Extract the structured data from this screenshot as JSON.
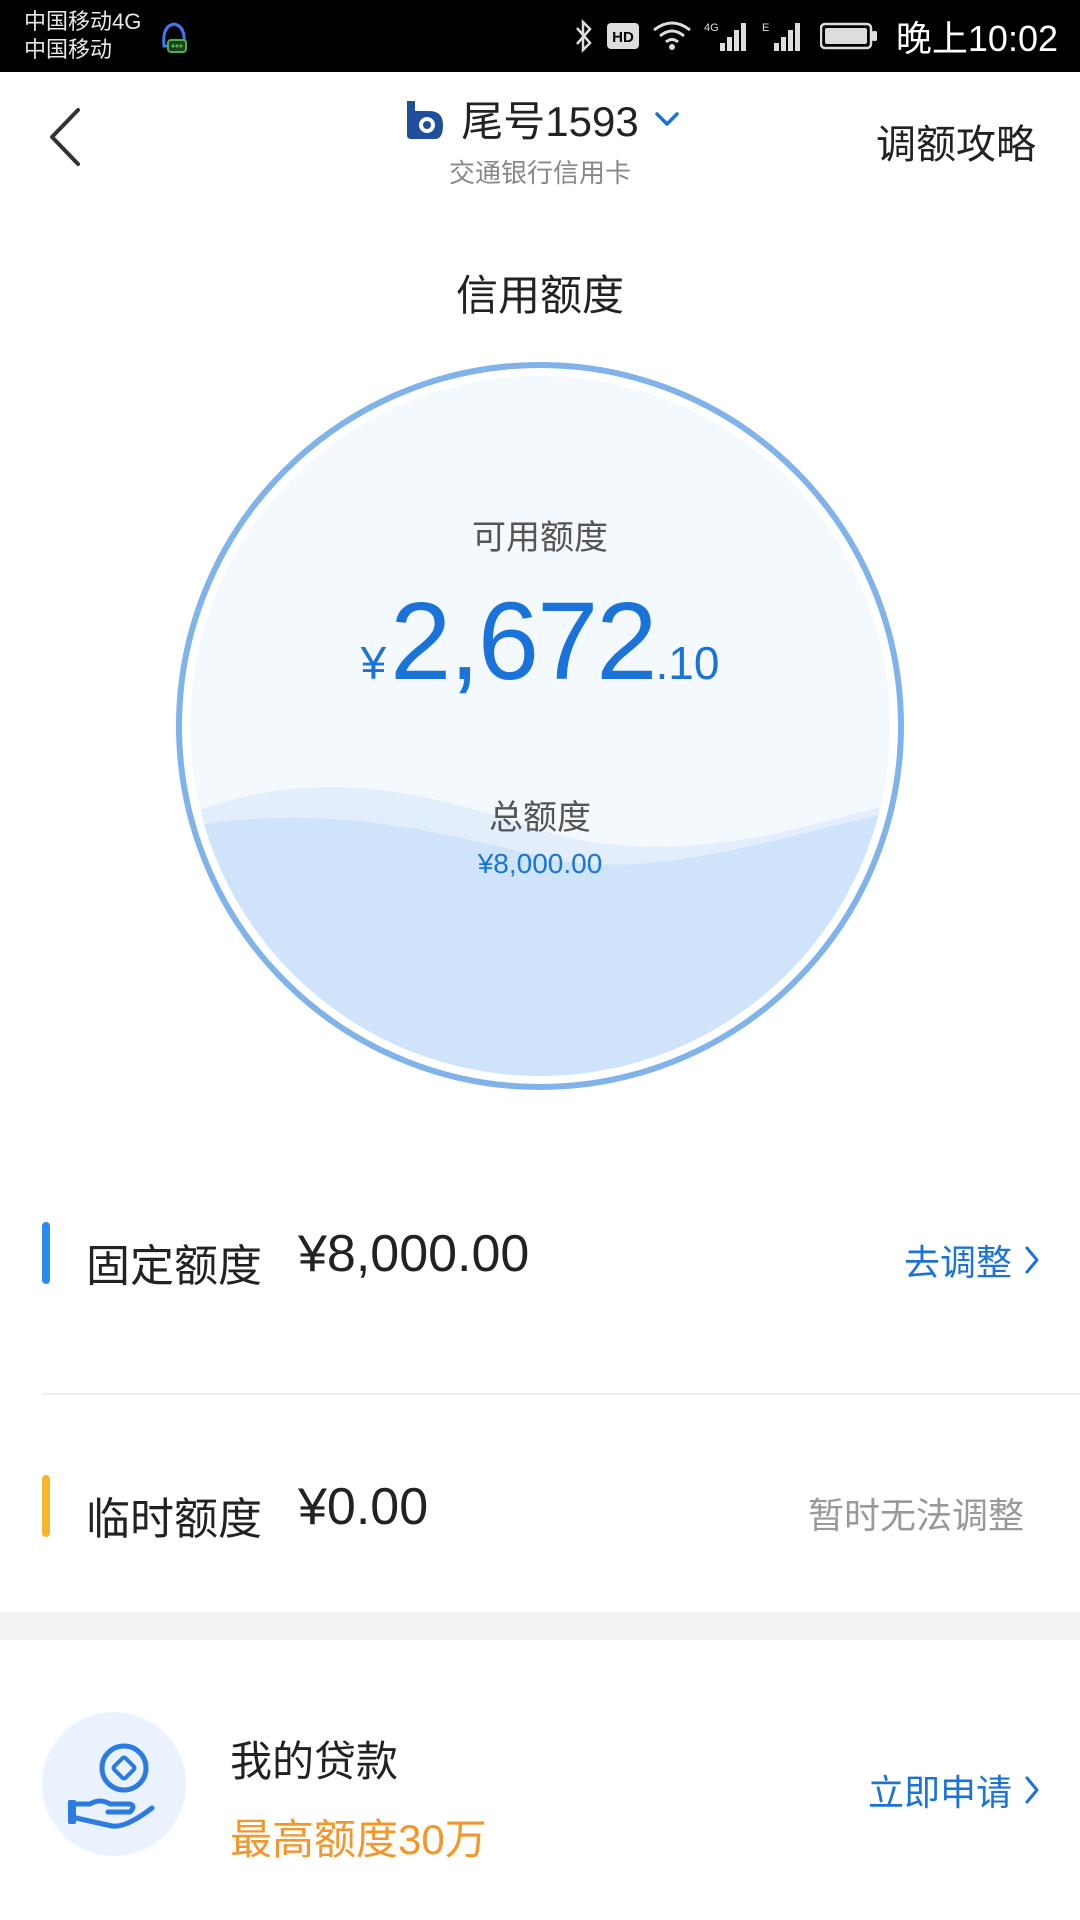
{
  "status_bar": {
    "carrier_line1": "中国移动4G",
    "carrier_line2": "中国移动",
    "time": "晚上10:02",
    "icons": [
      "bluetooth-icon",
      "hd-icon",
      "wifi-icon",
      "signal-4g-icon",
      "signal-e-icon",
      "battery-icon"
    ]
  },
  "header": {
    "title": "尾号1593",
    "subtitle": "交通银行信用卡",
    "right_link": "调额攻略"
  },
  "credit": {
    "section_title": "信用额度",
    "available_label": "可用额度",
    "currency": "¥",
    "available_int": "2,672",
    "available_dec": ".10",
    "total_label": "总额度",
    "total_amount": "¥8,000.00",
    "available_fraction": 0.334
  },
  "fixed": {
    "label": "固定额度",
    "value": "¥8,000.00",
    "action": "去调整",
    "bar_color": "#2b8cf0"
  },
  "temporary": {
    "label": "临时额度",
    "value": "¥0.00",
    "action": "暂时无法调整",
    "bar_color": "#f7b52c"
  },
  "loan": {
    "title": "我的贷款",
    "subtitle": "最高额度30万",
    "action": "立即申请"
  },
  "colors": {
    "accent": "#1a73d8",
    "orange": "#f4962a",
    "circle_ring": "#7fb3ea",
    "wave": "#cfe4fb"
  }
}
